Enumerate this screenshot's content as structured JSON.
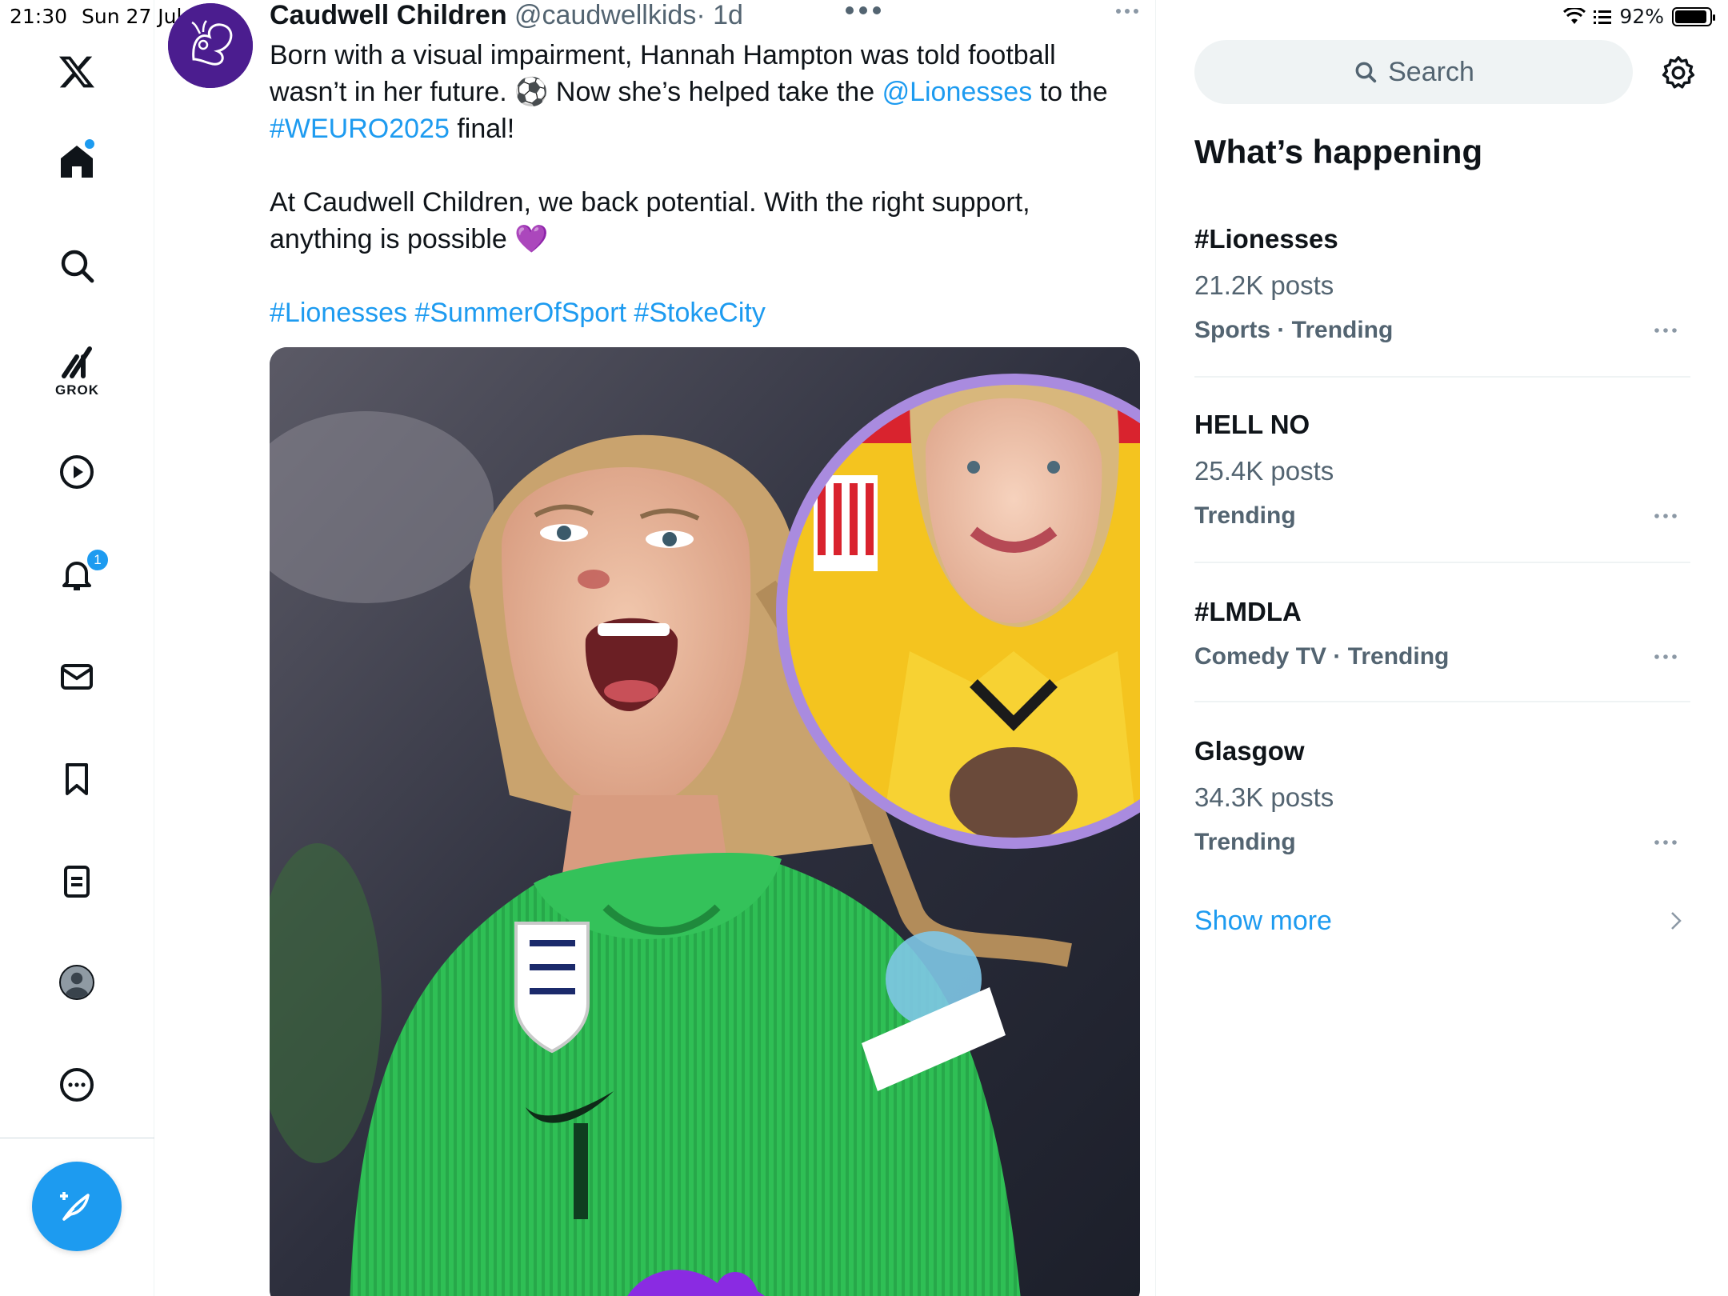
{
  "status_bar": {
    "time": "21:30",
    "date": "Sun 27 Jul",
    "battery": "92%",
    "battery_level": 0.92
  },
  "nav": {
    "items": [
      "x-logo",
      "home",
      "explore",
      "grok",
      "videos",
      "notifications",
      "messages",
      "bookmarks",
      "lists",
      "profile",
      "more"
    ],
    "grok_label": "GROK",
    "notification_count": "1"
  },
  "tweet": {
    "name": "Caudwell Children",
    "handle": "@caudwellkids",
    "time": "· 1d",
    "line1": "Born with a visual impairment, Hannah Hampton was told football",
    "line2_a": "wasn’t in her future. ⚽ Now she’s helped take the ",
    "line2_mention": "@Lionesses",
    "line2_b": " to the",
    "line3_tag": "#WEURO2025",
    "line3_b": " final!",
    "para2_line1": "At Caudwell Children, we back potential. With the right support,",
    "para2_line2": "anything is possible 💜",
    "hashtags": "#Lionesses #SummerOfSport #StokeCity"
  },
  "right": {
    "search_placeholder": "Search",
    "section_title": "What’s happening",
    "trends": [
      {
        "name": "#Lionesses",
        "posts": "21.2K posts",
        "meta": "Sports · Trending"
      },
      {
        "name": "HELL NO",
        "posts": "25.4K posts",
        "meta": "Trending"
      },
      {
        "name": "#LMDLA",
        "posts": "",
        "meta": "Comedy TV · Trending"
      },
      {
        "name": "Glasgow",
        "posts": "34.3K posts",
        "meta": "Trending"
      }
    ],
    "show_more": "Show more"
  },
  "colors": {
    "accent": "#1d9bf0",
    "text": "#0f1419",
    "secondary": "#536471"
  }
}
